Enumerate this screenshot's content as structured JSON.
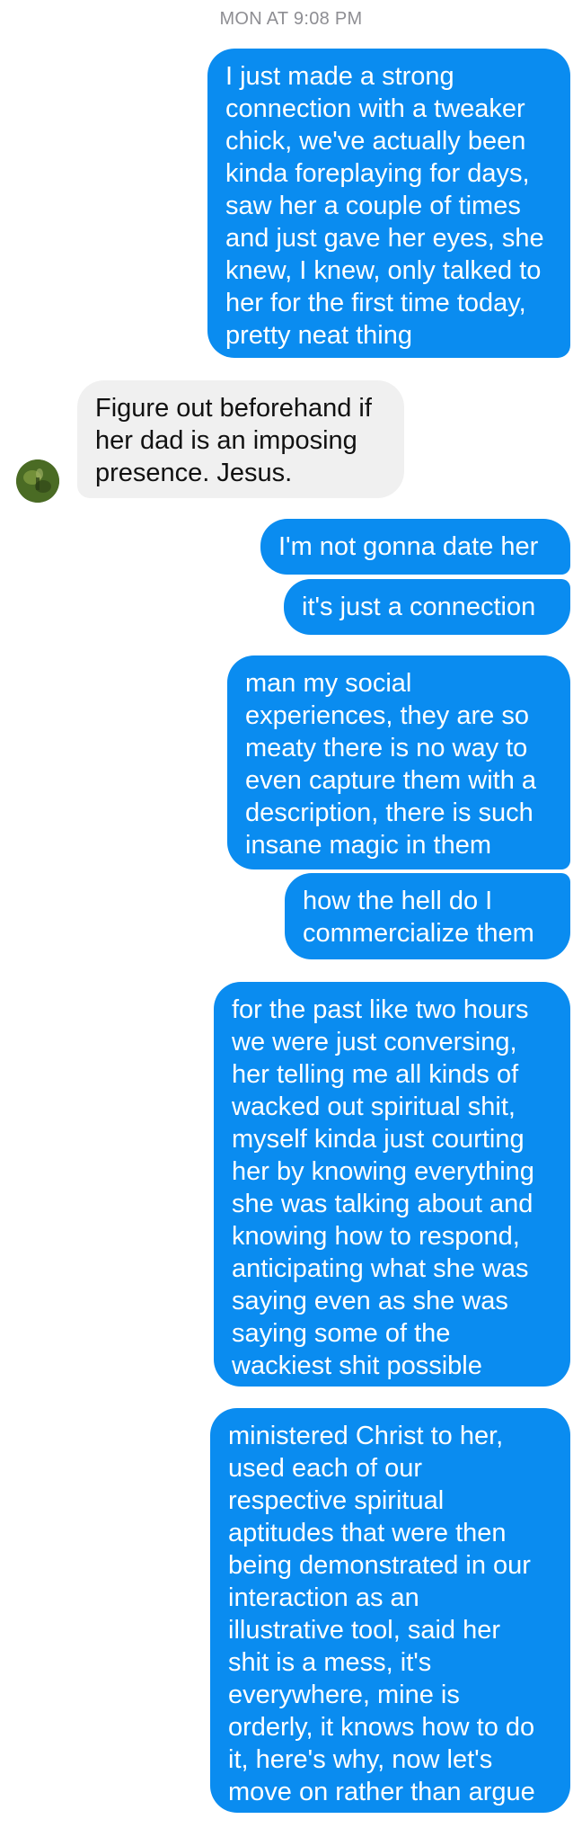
{
  "thread": {
    "timestamp": "MON AT 9:08 PM",
    "messages": [
      {
        "id": "m1",
        "sender": "me",
        "text": "I just made a strong\nconnection with a tweaker\nchick, we've actually been\nkinda foreplaying for days,\nsaw her a couple of times\nand just gave her eyes, she\nknew, I knew, only talked to\nher for the first time today,\npretty neat thing"
      },
      {
        "id": "m2",
        "sender": "them",
        "text": "Figure out beforehand if\nher dad is an imposing\npresence. Jesus."
      },
      {
        "id": "m3",
        "sender": "me",
        "text": "I'm not gonna date her"
      },
      {
        "id": "m4",
        "sender": "me",
        "text": "it's just a connection"
      },
      {
        "id": "m5",
        "sender": "me",
        "text": "man my social\nexperiences, they are so\nmeaty there is no way to\neven capture them with a\ndescription, there is such\ninsane magic in them"
      },
      {
        "id": "m6",
        "sender": "me",
        "text": "how the hell do I\ncommercialize them"
      },
      {
        "id": "m7",
        "sender": "me",
        "text": "for the past like two hours\nwe were just conversing,\nher telling me all kinds of\nwacked out spiritual shit,\nmyself kinda just courting\nher by knowing everything\nshe was talking about and\nknowing how to respond,\nanticipating what she was\nsaying even as she was\nsaying some of the\nwackiest shit possible"
      },
      {
        "id": "m8",
        "sender": "me",
        "text": "ministered Christ to her,\nused each of our\nrespective spiritual\naptitudes that were then\nbeing demonstrated in our\ninteraction as an\nillustrative tool, said her\nshit is a mess, it's\neverywhere, mine is\norderly, it knows how to do\nit, here's why, now let's\nmove on rather than argue"
      }
    ]
  },
  "colors": {
    "outgoing_bubble": "#0a8cf0",
    "incoming_bubble": "#f0f0f0",
    "timestamp": "#8e8e93"
  },
  "contact": {
    "avatar_icon": "contact-avatar-icon"
  }
}
